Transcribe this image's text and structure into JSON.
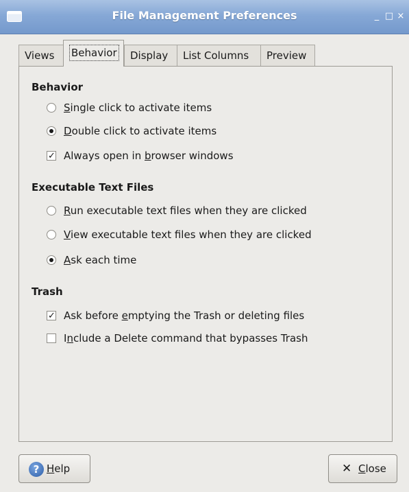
{
  "window": {
    "title": "File Management Preferences",
    "minimize": "_",
    "maximize": "□",
    "close": "×"
  },
  "tabs": [
    {
      "label": "Views",
      "active": false
    },
    {
      "label": "Behavior",
      "active": true
    },
    {
      "label": "Display",
      "active": false
    },
    {
      "label": "List Columns",
      "active": false
    },
    {
      "label": "Preview",
      "active": false
    }
  ],
  "sections": {
    "behavior": {
      "title": "Behavior",
      "single_click": {
        "mnemonic": "S",
        "rest": "ingle click to activate items",
        "selected": false
      },
      "double_click": {
        "mnemonic": "D",
        "rest": "ouble click to activate items",
        "selected": true
      },
      "always_open": {
        "pre": "Always open in ",
        "mnemonic": "b",
        "post": "rowser windows",
        "checked": true
      }
    },
    "executable": {
      "title": "Executable Text Files",
      "run": {
        "mnemonic": "R",
        "rest": "un executable text files when they are clicked",
        "selected": false
      },
      "view": {
        "mnemonic": "V",
        "rest": "iew executable text files when they are clicked",
        "selected": false
      },
      "ask": {
        "mnemonic": "A",
        "rest": "sk each time",
        "selected": true
      }
    },
    "trash": {
      "title": "Trash",
      "ask_before": {
        "pre": "Ask before ",
        "mnemonic": "e",
        "post": "mptying the Trash or deleting files",
        "checked": true
      },
      "include_delete": {
        "pre": "I",
        "mnemonic": "n",
        "post": "clude a Delete command that bypasses Trash",
        "checked": false
      }
    }
  },
  "buttons": {
    "help": {
      "mnemonic": "H",
      "rest": "elp",
      "icon": "?"
    },
    "close": {
      "mnemonic": "C",
      "rest": "lose",
      "icon": "✕"
    }
  }
}
